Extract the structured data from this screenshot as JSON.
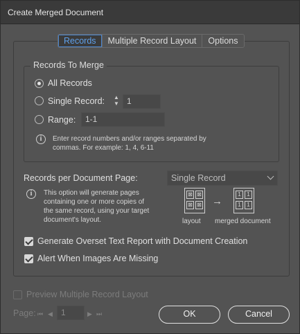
{
  "dialog": {
    "title": "Create Merged Document"
  },
  "tabs": [
    "Records",
    "Multiple Record Layout",
    "Options"
  ],
  "records_group": {
    "legend": "Records To Merge",
    "all_records": "All Records",
    "single_record": "Single Record:",
    "single_record_value": "1",
    "range": "Range:",
    "range_value": "1-1",
    "info_line1": "Enter record numbers and/or ranges separated by",
    "info_line2": "commas. For example: 1, 4, 6-11"
  },
  "per_page": {
    "label": "Records per Document Page:",
    "selected": "Single Record",
    "info_line1": "This option will generate pages",
    "info_line2": "containing one or more copies of",
    "info_line3": "the same record, using your target",
    "info_line4": "document's layout.",
    "layout_caption": "layout",
    "merged_caption": "merged document",
    "layout_glyph": "⊠",
    "merged_glyph": "1"
  },
  "options": {
    "overset": "Generate Overset Text Report with Document Creation",
    "images": "Alert When Images Are Missing",
    "overset_checked": true,
    "images_checked": true
  },
  "preview": {
    "label": "Preview Multiple Record Layout",
    "checked": false
  },
  "pager": {
    "label": "Page:",
    "value": "1"
  },
  "buttons": {
    "ok": "OK",
    "cancel": "Cancel"
  },
  "icons": {
    "info": "i",
    "arrow": "→",
    "first": "⏮",
    "prev": "◀",
    "next": "▶",
    "last": "⏭",
    "spin_up": "▲",
    "spin_down": "▼"
  }
}
